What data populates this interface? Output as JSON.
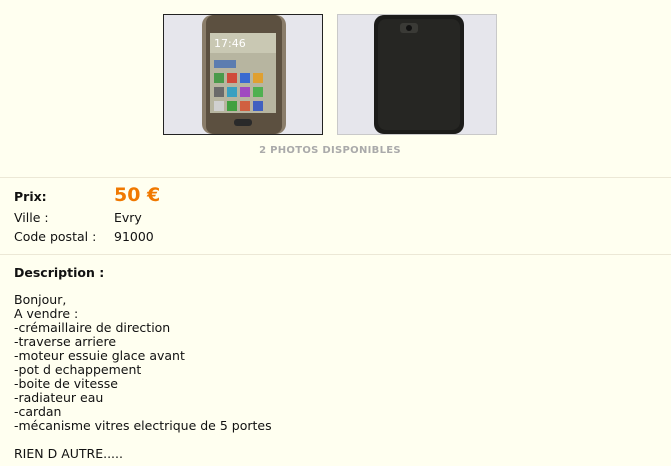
{
  "gallery": {
    "photos_count_label": "2 PHOTOS DISPONIBLES"
  },
  "details": {
    "price_label": "Prix:",
    "price_value": "50 €",
    "city_label": "Ville :",
    "city_value": "Evry",
    "postal_label": "Code postal :",
    "postal_value": "91000"
  },
  "description": {
    "title": "Description :",
    "lines": [
      "Bonjour,",
      "A vendre :",
      "-crémaillaire de direction",
      "-traverse arriere",
      "-moteur essuie glace avant",
      "-pot d echappement",
      "-boite de vitesse",
      "-radiateur eau",
      "-cardan",
      "-mécanisme vitres electrique de 5 portes",
      "",
      "RIEN D AUTRE....."
    ]
  },
  "colors": {
    "background": "#fffff0",
    "price": "#f07800"
  },
  "thumbnail_screen_time": "17:46"
}
